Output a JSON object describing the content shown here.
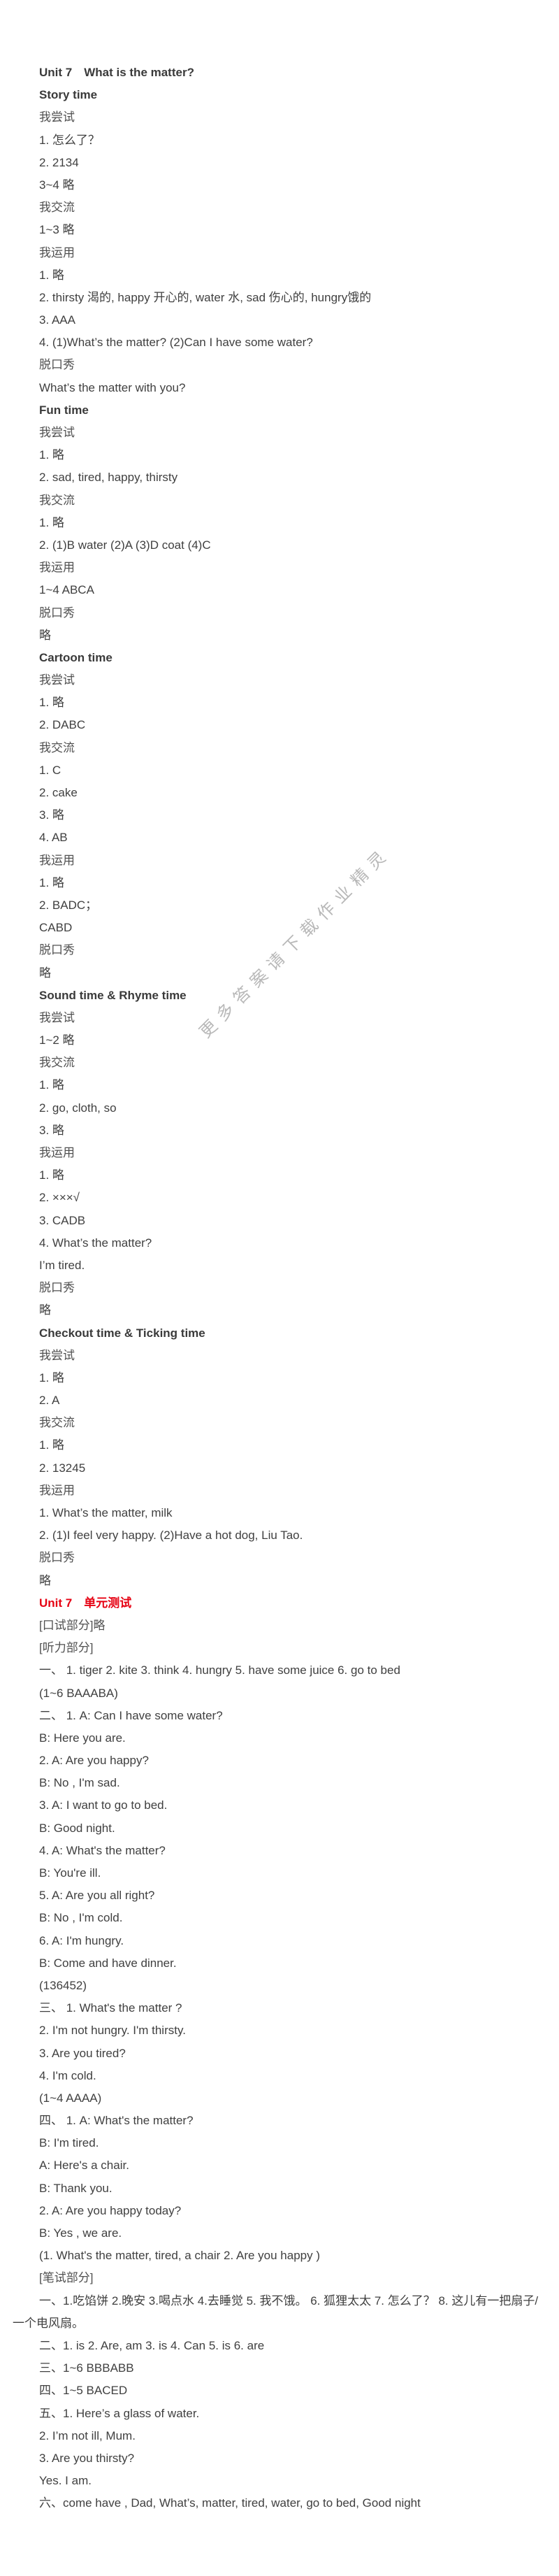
{
  "watermark": "更多答案请下载作业精灵",
  "lines": [
    {
      "t": "Unit 7　What is the matter?",
      "k": "h"
    },
    {
      "t": "Story time",
      "k": "h"
    },
    {
      "t": "我尝试",
      "k": "sub"
    },
    {
      "t": "1. 怎么了？",
      "k": ""
    },
    {
      "t": "2. 2134",
      "k": ""
    },
    {
      "t": "3~4  略",
      "k": ""
    },
    {
      "t": "我交流",
      "k": "sub"
    },
    {
      "t": "1~3  略",
      "k": ""
    },
    {
      "t": "我运用",
      "k": "sub"
    },
    {
      "t": "1. 略",
      "k": ""
    },
    {
      "t": "2. thirsty 渴的, happy 开心的, water 水, sad 伤心的, hungry饿的",
      "k": ""
    },
    {
      "t": "3. AAA",
      "k": ""
    },
    {
      "t": "4.  (1)What’s the matter?   (2)Can I have some water?",
      "k": ""
    },
    {
      "t": "脱口秀",
      "k": "sub"
    },
    {
      "t": "What’s the matter with you?",
      "k": ""
    },
    {
      "t": "Fun time",
      "k": "h"
    },
    {
      "t": "我尝试",
      "k": "sub"
    },
    {
      "t": "1. 略",
      "k": ""
    },
    {
      "t": "2. sad, tired, happy, thirsty",
      "k": ""
    },
    {
      "t": "我交流",
      "k": "sub"
    },
    {
      "t": "1. 略",
      "k": ""
    },
    {
      "t": "2. (1)B  water  (2)A  (3)D  coat  (4)C",
      "k": ""
    },
    {
      "t": "我运用",
      "k": "sub"
    },
    {
      "t": "1~4  ABCA",
      "k": ""
    },
    {
      "t": "脱口秀",
      "k": "sub"
    },
    {
      "t": "略",
      "k": ""
    },
    {
      "t": "Cartoon time",
      "k": "h"
    },
    {
      "t": "我尝试",
      "k": "sub"
    },
    {
      "t": "1. 略",
      "k": ""
    },
    {
      "t": "2. DABC",
      "k": ""
    },
    {
      "t": "我交流",
      "k": "sub"
    },
    {
      "t": "1. C",
      "k": ""
    },
    {
      "t": "2. cake",
      "k": ""
    },
    {
      "t": "3. 略",
      "k": ""
    },
    {
      "t": "4. AB",
      "k": ""
    },
    {
      "t": "我运用",
      "k": "sub"
    },
    {
      "t": "1. 略",
      "k": ""
    },
    {
      "t": "2. BADC；",
      "k": ""
    },
    {
      "t": "CABD",
      "k": ""
    },
    {
      "t": "脱口秀",
      "k": "sub"
    },
    {
      "t": "略",
      "k": ""
    },
    {
      "t": "Sound time & Rhyme time",
      "k": "h"
    },
    {
      "t": "我尝试",
      "k": "sub"
    },
    {
      "t": "1~2  略",
      "k": ""
    },
    {
      "t": "我交流",
      "k": "sub"
    },
    {
      "t": "1. 略",
      "k": ""
    },
    {
      "t": "2. go, cloth, so",
      "k": ""
    },
    {
      "t": "3. 略",
      "k": ""
    },
    {
      "t": "我运用",
      "k": "sub"
    },
    {
      "t": "1. 略",
      "k": ""
    },
    {
      "t": "2. ×××√",
      "k": ""
    },
    {
      "t": "3. CADB",
      "k": ""
    },
    {
      "t": "4. What’s the matter?",
      "k": ""
    },
    {
      "t": "I’m tired.",
      "k": ""
    },
    {
      "t": "脱口秀",
      "k": "sub"
    },
    {
      "t": "略",
      "k": ""
    },
    {
      "t": "Checkout time & Ticking time",
      "k": "h"
    },
    {
      "t": "我尝试",
      "k": "sub"
    },
    {
      "t": "1. 略",
      "k": ""
    },
    {
      "t": "2. A",
      "k": ""
    },
    {
      "t": "我交流",
      "k": "sub"
    },
    {
      "t": "1. 略",
      "k": ""
    },
    {
      "t": "2. 13245",
      "k": ""
    },
    {
      "t": "我运用",
      "k": "sub"
    },
    {
      "t": "1. What’s the matter, milk",
      "k": ""
    },
    {
      "t": "2. (1)I feel very happy.  (2)Have a hot dog, Liu Tao.",
      "k": ""
    },
    {
      "t": "脱口秀",
      "k": "sub"
    },
    {
      "t": "略",
      "k": ""
    },
    {
      "t": "Unit 7　单元测试",
      "k": "red"
    },
    {
      "t": "[口试部分]略",
      "k": "sub"
    },
    {
      "t": "[听力部分]",
      "k": "sub"
    },
    {
      "t": "一、 1. tiger   2. kite   3. think   4. hungry    5. have some juice    6. go to bed",
      "k": ""
    },
    {
      "t": "(1~6  BAAABA)",
      "k": ""
    },
    {
      "t": "二、 1. A: Can I have some water?",
      "k": ""
    },
    {
      "t": "B: Here you are.",
      "k": ""
    },
    {
      "t": "2. A: Are you happy?",
      "k": ""
    },
    {
      "t": "B: No , I'm sad.",
      "k": ""
    },
    {
      "t": "3. A: I want to go to bed.",
      "k": ""
    },
    {
      "t": "B: Good night.",
      "k": ""
    },
    {
      "t": "4. A: What's the matter?",
      "k": ""
    },
    {
      "t": "B: You're ill.",
      "k": ""
    },
    {
      "t": "5. A: Are you all right?",
      "k": ""
    },
    {
      "t": "B: No , I'm cold.",
      "k": ""
    },
    {
      "t": "6. A: I'm hungry.",
      "k": ""
    },
    {
      "t": "B: Come and have dinner.",
      "k": ""
    },
    {
      "t": "(136452)",
      "k": ""
    },
    {
      "t": "三、 1. What's the matter ?",
      "k": ""
    },
    {
      "t": "2. I'm not hungry. I'm thirsty.",
      "k": ""
    },
    {
      "t": "3. Are you tired?",
      "k": ""
    },
    {
      "t": "4. I'm cold.",
      "k": ""
    },
    {
      "t": "(1~4  AAAA)",
      "k": ""
    },
    {
      "t": "四、 1. A: What's the matter?",
      "k": ""
    },
    {
      "t": "B: I'm tired.",
      "k": ""
    },
    {
      "t": "A: Here's a chair.",
      "k": ""
    },
    {
      "t": "B: Thank you.",
      "k": ""
    },
    {
      "t": "2. A: Are you happy today?",
      "k": ""
    },
    {
      "t": "B: Yes , we are.",
      "k": ""
    },
    {
      "t": "(1. What's the matter, tired, a chair  2. Are you happy )",
      "k": ""
    },
    {
      "t": "[笔试部分]",
      "k": "sub"
    },
    {
      "t": "一、1.吃馅饼  2.晚安   3.喝点水  4.去睡觉  5. 我不饿。  6. 狐狸太太  7. 怎么了？  8. 这儿有一把扇子/一个电风扇。",
      "k": "wrap"
    },
    {
      "t": "二、1. is  2. Are, am  3. is  4. Can  5. is  6. are",
      "k": ""
    },
    {
      "t": "三、1~6  BBBABB",
      "k": ""
    },
    {
      "t": "四、1~5  BACED",
      "k": ""
    },
    {
      "t": "五、1. Here’s a glass of water.",
      "k": ""
    },
    {
      "t": "2. I’m not ill, Mum.",
      "k": ""
    },
    {
      "t": "3. Are you thirsty?",
      "k": ""
    },
    {
      "t": "Yes. I am.",
      "k": ""
    },
    {
      "t": "六、come have , Dad, What’s, matter, tired, water, go to bed, Good night",
      "k": ""
    }
  ]
}
